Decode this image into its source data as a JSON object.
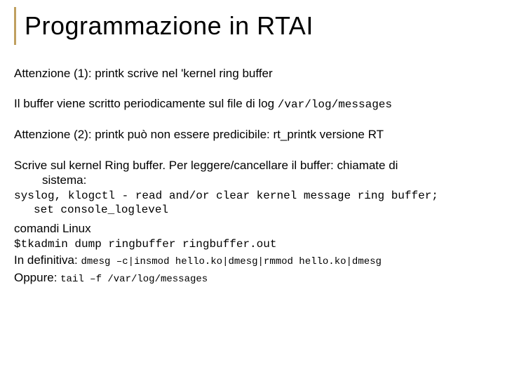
{
  "title": "Programmazione in RTAI",
  "p1": "Attenzione (1): printk scrive nel 'kernel ring buffer",
  "p2a": "Il buffer viene scritto periodicamente sul file di log ",
  "p2b": "/var/log/messages",
  "p3": "Attenzione (2): printk può non essere predicibile: rt_printk versione RT",
  "p4a": "Scrive sul kernel Ring buffer. Per leggere/cancellare il buffer: chiamate di",
  "p4b": "sistema:",
  "p5a": "syslog,  klogctl  -  read   and/or clear kernel message ring buffer;",
  "p5b": "set  console_loglevel",
  "p6": "comandi Linux",
  "p7": "$tkadmin dump ringbuffer ringbuffer.out",
  "p8a": "In definitiva: ",
  "p8b": "dmesg –c|insmod hello.ko|dmesg|rmmod hello.ko|dmesg",
  "p9a": "Oppure: ",
  "p9b": "tail –f /var/log/messages"
}
